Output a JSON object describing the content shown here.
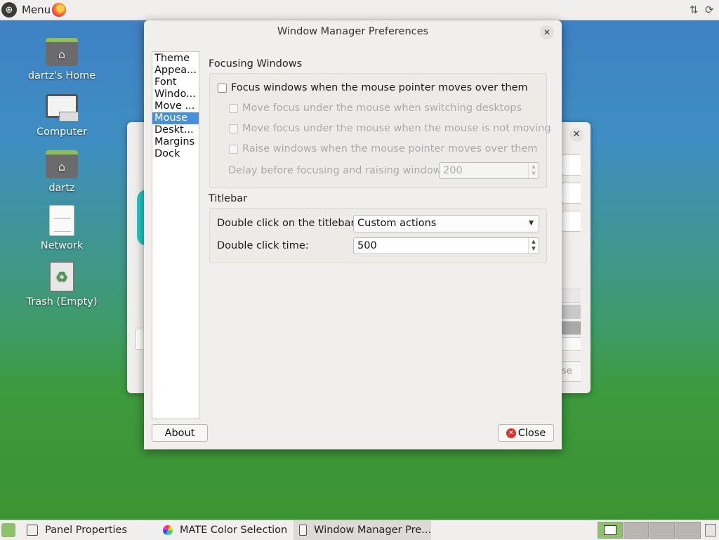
{
  "top_panel": {
    "menu_label": "Menu",
    "icons": [
      "distro-logo-icon",
      "firefox-icon",
      "network-icon",
      "update-icon"
    ]
  },
  "desktop": {
    "icons": [
      {
        "label": "dartz's Home",
        "icon": "home-folder-icon"
      },
      {
        "label": "Computer",
        "icon": "computer-icon"
      },
      {
        "label": "dartz",
        "icon": "home-folder-icon"
      },
      {
        "label": "Network",
        "icon": "network-icon"
      },
      {
        "label": "Trash (Empty)",
        "icon": "trash-icon"
      }
    ]
  },
  "background_window": {
    "button_partial": "se"
  },
  "dialog": {
    "title": "Window Manager Preferences",
    "sidebar": [
      "Theme",
      "Appea...",
      "Font",
      "Windo...",
      "Move ...",
      "Mouse",
      "Deskt...",
      "Margins",
      "Dock"
    ],
    "selected_index": 5,
    "focusing": {
      "heading": "Focusing Windows",
      "focus_follows_mouse": "Focus windows when the mouse pointer moves over them",
      "focus_switching_desktops": "Move focus under the mouse when switching desktops",
      "focus_not_moving": "Move focus under the mouse when the mouse is not moving",
      "raise_windows": "Raise windows when the mouse pointer moves over them",
      "delay_label": "Delay before focusing and raising windows:",
      "delay_value": "200"
    },
    "titlebar": {
      "heading": "Titlebar",
      "double_click_label": "Double click on the titlebar:",
      "double_click_value": "Custom actions",
      "double_click_time_label": "Double click time:",
      "double_click_time_value": "500"
    },
    "about_label": "About",
    "close_label": "Close"
  },
  "bottom_panel": {
    "tasks": [
      {
        "label": "Panel Properties"
      },
      {
        "label": "MATE Color Selection"
      },
      {
        "label": "Window Manager Pre..."
      }
    ]
  }
}
